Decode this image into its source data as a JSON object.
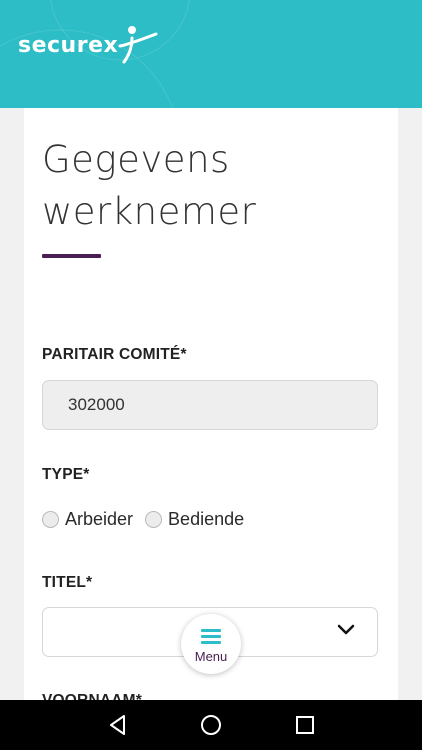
{
  "header": {
    "logo_text": "securex",
    "brand_color": "#2dbdc6"
  },
  "page": {
    "title": "Gegevens werknemer",
    "accent_color": "#4a1f55"
  },
  "form": {
    "paritair_label": "PARITAIR COMITÉ*",
    "paritair_value": "302000",
    "type_label": "TYPE*",
    "type_options": [
      "Arbeider",
      "Bediende"
    ],
    "titel_label": "TITEL*",
    "titel_value": "",
    "next_label": "VOORNAAM*"
  },
  "menu": {
    "label": "Menu",
    "icon": "hamburger-icon"
  },
  "system_nav": {
    "icons": [
      "back-icon",
      "home-icon",
      "recents-icon"
    ]
  }
}
